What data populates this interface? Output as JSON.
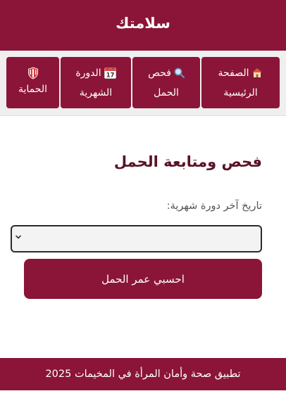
{
  "header": {
    "title": "سلامتك"
  },
  "nav": {
    "items": [
      {
        "icon": "house-icon",
        "label_line1": "الصفحة",
        "label_line2": "الرئيسية"
      },
      {
        "icon": "magnifier-icon",
        "label_line1": "فحص",
        "label_line2": "الحمل"
      },
      {
        "icon": "calendar-icon",
        "calendar_number": "17",
        "label_line1": "الدورة",
        "label_line2": "الشهرية"
      },
      {
        "icon": "shield-icon",
        "label_line1": "الحماية"
      }
    ]
  },
  "main": {
    "title": "فحص ومتابعة الحمل",
    "date_label": "تاريخ آخر دورة شهرية:",
    "date_value": "",
    "calc_button_label": "احسبي عمر الحمل"
  },
  "footer": {
    "text": "تطبيق صحة وأمان المرأة في المخيمات 2025"
  },
  "colors": {
    "brand": "#8a1538",
    "title_text": "#5a1326",
    "nav_background": "#efefef",
    "page_background": "#ffffff"
  }
}
